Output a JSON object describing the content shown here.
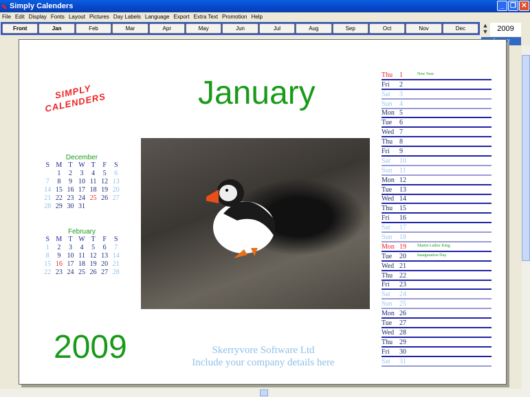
{
  "title": "Simply Calenders",
  "menu": [
    "File",
    "Edit",
    "Display",
    "Fonts",
    "Layout",
    "Pictures",
    "Day Labels",
    "Language",
    "Export",
    "Extra Text",
    "Promotion",
    "Help"
  ],
  "tabs": [
    "Front",
    "Jan",
    "Feb",
    "Mar",
    "Apr",
    "May",
    "Jun",
    "Jul",
    "Aug",
    "Sep",
    "Oct",
    "Nov",
    "Dec"
  ],
  "year": "2009",
  "selected_month": "January",
  "logo": "SIMPLY CALENDERS",
  "page": {
    "month": "January",
    "year": "2009",
    "company1": "Skerryvore Software Ltd",
    "company2": "Include your company details here"
  },
  "dow": [
    "S",
    "M",
    "T",
    "W",
    "T",
    "F",
    "S"
  ],
  "mini": [
    {
      "title": "December",
      "weeks": [
        [
          "",
          "1",
          "2",
          "3",
          "4",
          "5",
          "6"
        ],
        [
          "7",
          "8",
          "9",
          "10",
          "11",
          "12",
          "13"
        ],
        [
          "14",
          "15",
          "16",
          "17",
          "18",
          "19",
          "20"
        ],
        [
          "21",
          "22",
          "23",
          "24",
          "25",
          "26",
          "27"
        ],
        [
          "28",
          "29",
          "30",
          "31",
          "",
          "",
          ""
        ]
      ],
      "holidays": [
        "25"
      ]
    },
    {
      "title": "February",
      "weeks": [
        [
          "1",
          "2",
          "3",
          "4",
          "5",
          "6",
          "7"
        ],
        [
          "8",
          "9",
          "10",
          "11",
          "12",
          "13",
          "14"
        ],
        [
          "15",
          "16",
          "17",
          "18",
          "19",
          "20",
          "21"
        ],
        [
          "22",
          "23",
          "24",
          "25",
          "26",
          "27",
          "28"
        ]
      ],
      "holidays": [
        "16"
      ]
    }
  ],
  "days": [
    [
      "Thu",
      "1",
      "New Year."
    ],
    [
      "Fri",
      "2"
    ],
    [
      "Sat",
      "3"
    ],
    [
      "Sun",
      "4"
    ],
    [
      "Mon",
      "5"
    ],
    [
      "Tue",
      "6"
    ],
    [
      "Wed",
      "7"
    ],
    [
      "Thu",
      "8"
    ],
    [
      "Fri",
      "9"
    ],
    [
      "Sat",
      "10"
    ],
    [
      "Sun",
      "11"
    ],
    [
      "Mon",
      "12"
    ],
    [
      "Tue",
      "13"
    ],
    [
      "Wed",
      "14"
    ],
    [
      "Thu",
      "15"
    ],
    [
      "Fri",
      "16"
    ],
    [
      "Sat",
      "17"
    ],
    [
      "Sun",
      "18"
    ],
    [
      "Mon",
      "19",
      "Martin Luther King."
    ],
    [
      "Tue",
      "20",
      "Inauguration Day."
    ],
    [
      "Wed",
      "21"
    ],
    [
      "Thu",
      "22"
    ],
    [
      "Fri",
      "23"
    ],
    [
      "Sat",
      "24"
    ],
    [
      "Sun",
      "25"
    ],
    [
      "Mon",
      "26"
    ],
    [
      "Tue",
      "27"
    ],
    [
      "Wed",
      "28"
    ],
    [
      "Thu",
      "29"
    ],
    [
      "Fri",
      "30"
    ],
    [
      "Sat",
      "31"
    ]
  ],
  "holiday_days": [
    "1",
    "19"
  ]
}
